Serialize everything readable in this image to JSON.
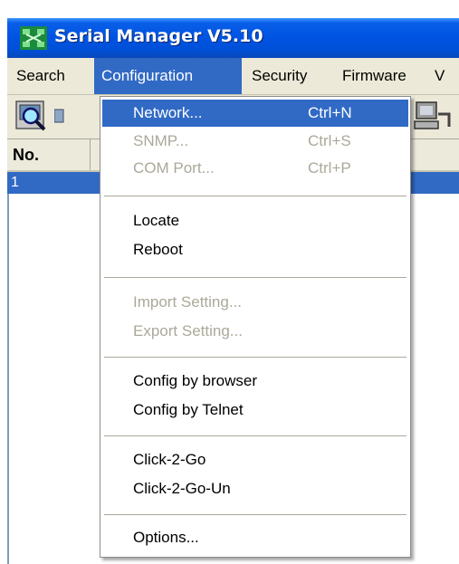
{
  "window": {
    "title": "Serial Manager V5.10"
  },
  "menubar": {
    "items": [
      {
        "label": "Search"
      },
      {
        "label": "Configuration"
      },
      {
        "label": "Security"
      },
      {
        "label": "Firmware"
      },
      {
        "label": "V"
      }
    ]
  },
  "toolbar": {
    "icons": [
      "search-magnifier-icon",
      "partial-icon",
      "network-computer-icon"
    ]
  },
  "list": {
    "columns": [
      {
        "label": "No."
      }
    ],
    "rows": [
      {
        "no": "1"
      }
    ]
  },
  "configuration_menu": {
    "items": [
      {
        "label": "Network...",
        "shortcut": "Ctrl+N"
      },
      {
        "label": "SNMP...",
        "shortcut": "Ctrl+S"
      },
      {
        "label": "COM Port...",
        "shortcut": "Ctrl+P"
      },
      {
        "label": "Locate"
      },
      {
        "label": "Reboot"
      },
      {
        "label": "Import Setting..."
      },
      {
        "label": "Export Setting..."
      },
      {
        "label": "Config by browser"
      },
      {
        "label": "Config by Telnet"
      },
      {
        "label": "Click-2-Go"
      },
      {
        "label": "Click-2-Go-Un"
      },
      {
        "label": "Options..."
      }
    ]
  },
  "colors": {
    "title_bar": "#0054e3",
    "selection": "#316ac5",
    "disabled_text": "#aca899",
    "menu_face": "#ece9d8"
  }
}
